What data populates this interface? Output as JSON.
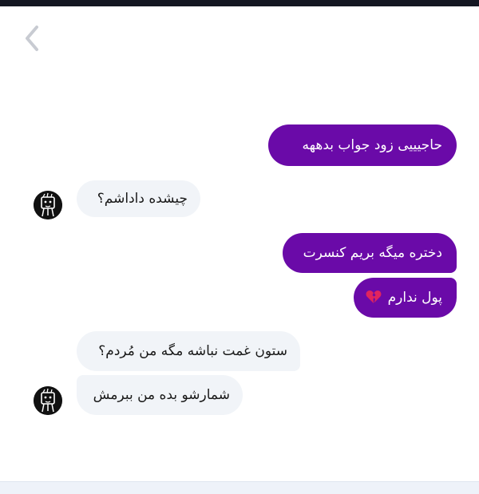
{
  "colors": {
    "outgoing_bubble": "#6a0aa8",
    "incoming_bubble": "#f1f4f8",
    "top_bar": "#141722"
  },
  "icons": {
    "back": "chevron-left-icon",
    "avatar": "doodle-face-avatar",
    "heart": "broken-heart-emoji"
  },
  "messages": [
    {
      "from": "me",
      "text": "حاجیییی زود جواب بدههه"
    },
    {
      "from": "them",
      "text": "چیشده داداشم؟"
    },
    {
      "from": "me",
      "text": "دختره میگه بریم کنسرت"
    },
    {
      "from": "me",
      "text": "پول ندارم"
    },
    {
      "from": "them",
      "text": "ستون غمت نباشه مگه من مُردم؟"
    },
    {
      "from": "them",
      "text": "شمارشو بده من ببرمش"
    }
  ]
}
